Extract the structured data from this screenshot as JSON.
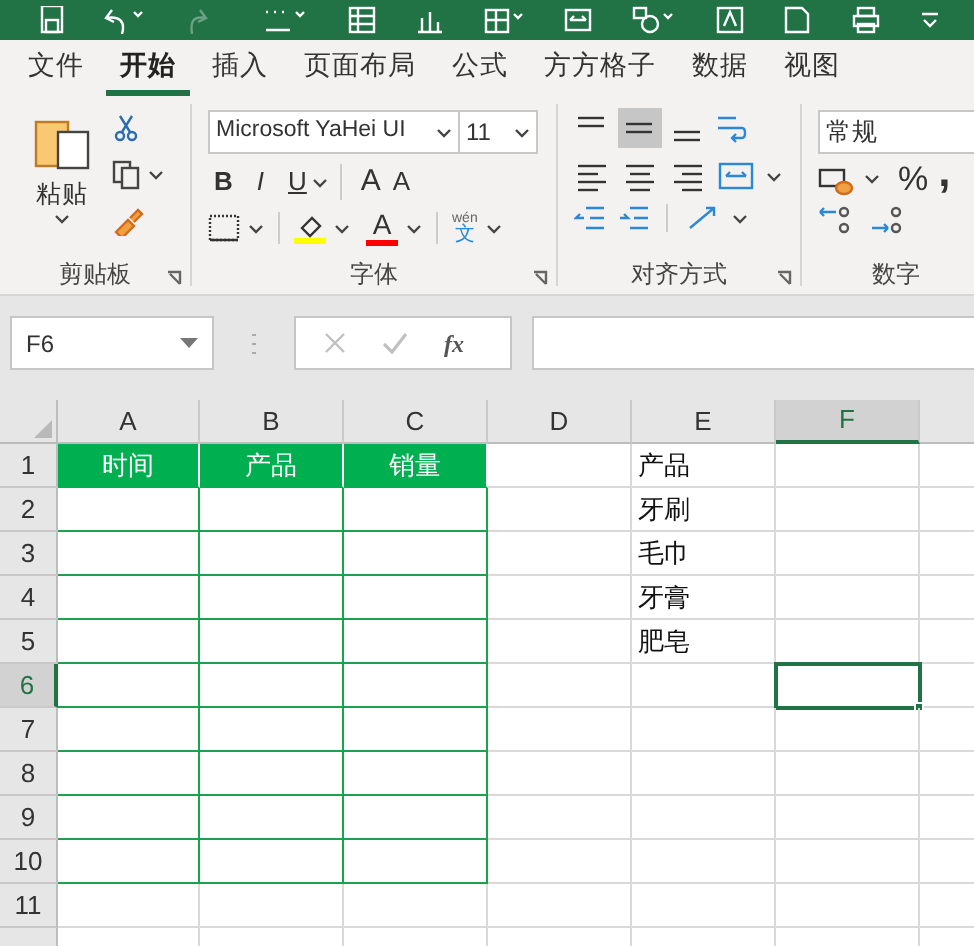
{
  "tabs": [
    {
      "label": "文件",
      "selected": false
    },
    {
      "label": "开始",
      "selected": true
    },
    {
      "label": "插入",
      "selected": false
    },
    {
      "label": "页面布局",
      "selected": false
    },
    {
      "label": "公式",
      "selected": false
    },
    {
      "label": "方方格子",
      "selected": false
    },
    {
      "label": "数据",
      "selected": false
    },
    {
      "label": "视图",
      "selected": false
    }
  ],
  "ribbon": {
    "clipboard": {
      "paste_label": "粘贴",
      "group_label": "剪贴板"
    },
    "font": {
      "font_name": "Microsoft YaHei UI",
      "font_size": "11",
      "bold": "B",
      "italic": "I",
      "underline": "U",
      "grow": "A",
      "shrink": "A",
      "font_color": "A",
      "phonetic_ruby": "wén",
      "phonetic_char": "文",
      "group_label": "字体"
    },
    "alignment": {
      "group_label": "对齐方式"
    },
    "number": {
      "format": "常规",
      "percent": "%",
      "comma": ",",
      "group_label": "数字"
    }
  },
  "formula_bar": {
    "name_box": "F6",
    "function_label": "fx"
  },
  "sheet": {
    "columns": [
      {
        "label": "A",
        "selected": false
      },
      {
        "label": "B",
        "selected": false
      },
      {
        "label": "C",
        "selected": false
      },
      {
        "label": "D",
        "selected": false
      },
      {
        "label": "E",
        "selected": false
      },
      {
        "label": "F",
        "selected": true
      }
    ],
    "rows": [
      {
        "label": "1",
        "selected": false,
        "cells": {
          "A": "时间",
          "B": "产品",
          "C": "销量",
          "E": "产品"
        }
      },
      {
        "label": "2",
        "selected": false,
        "cells": {
          "E": "牙刷"
        }
      },
      {
        "label": "3",
        "selected": false,
        "cells": {
          "E": "毛巾"
        }
      },
      {
        "label": "4",
        "selected": false,
        "cells": {
          "E": "牙膏"
        }
      },
      {
        "label": "5",
        "selected": false,
        "cells": {
          "E": "肥皂"
        }
      },
      {
        "label": "6",
        "selected": true,
        "cells": {}
      },
      {
        "label": "7",
        "selected": false,
        "cells": {}
      },
      {
        "label": "8",
        "selected": false,
        "cells": {}
      },
      {
        "label": "9",
        "selected": false,
        "cells": {}
      },
      {
        "label": "10",
        "selected": false,
        "cells": {}
      },
      {
        "label": "11",
        "selected": false,
        "cells": {}
      }
    ]
  }
}
